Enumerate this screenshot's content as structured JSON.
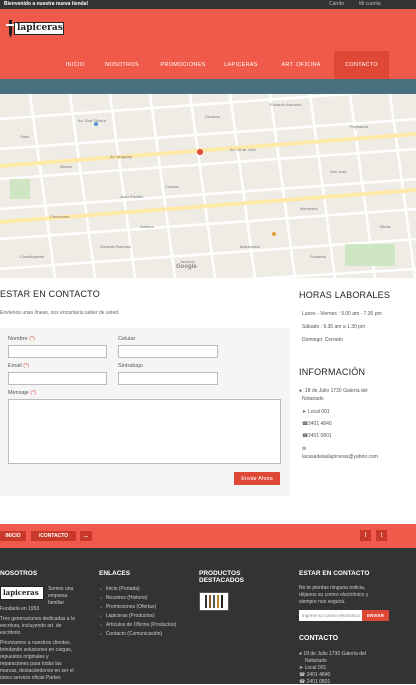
{
  "topbar": {
    "welcome": "Bienvenido a nuestra nueva tienda!",
    "cart": "Carrito",
    "account": "Mi cuenta"
  },
  "brand": {
    "logo_text": "lapiceras"
  },
  "nav": {
    "items": [
      {
        "label": "Inicio"
      },
      {
        "label": "Nosotros"
      },
      {
        "label": "Promociones"
      },
      {
        "label": "Lapiceras"
      },
      {
        "label": "Art. Oficina"
      },
      {
        "label": "Contacto"
      }
    ],
    "active": "Contacto"
  },
  "map": {
    "labels": [
      "Av. Uruguay",
      "Av. 18 de Julio",
      "Av. Gral. Rivera",
      "Colonia",
      "Mercedes",
      "Canelones",
      "Maldonado",
      "Paysandú",
      "Soriano",
      "San José",
      "Constituyente",
      "Durazno",
      "Gonzalo Ramírez",
      "Eduardo Acevedo",
      "Juan Paullier",
      "Minas",
      "Blanes",
      "Salto",
      "Jackson",
      "Scoseria"
    ],
    "watermark": "Google"
  },
  "contact": {
    "title": "ESTAR EN CONTACTO",
    "subtitle": "Envíenos unas líneas, nos encantaría saber de usted.",
    "labels": {
      "name": "Nombre",
      "phone": "Celular",
      "email": "Email",
      "subject": "Sintrabajo",
      "message": "Mensaje"
    },
    "required_mark": "(*)",
    "submit": "Enviar Ahora"
  },
  "hours": {
    "title": "HORAS LABORALES",
    "lines": [
      "Lunes - Viernes : 9.00 am - 7.30 pm",
      "Sábado : 9.30 am a 1.30 pm",
      "Domingo: Cerrado"
    ]
  },
  "info": {
    "title": "INFORMACIÓN",
    "address_1": "18 de Julio 1730 Galería del",
    "address_2": "Notariado",
    "local": "Local 001",
    "phone_1": "2401 4840",
    "phone_2": "2401 0801",
    "email": "lacasadelaslapiceras@yahoo.com"
  },
  "breadcrumb": {
    "items": [
      "INICIO",
      "/CONTACTO",
      "..."
    ]
  },
  "social": {
    "facebook": "f",
    "twitter": "t"
  },
  "footer": {
    "nosotros": {
      "title": "NOSOTROS",
      "tag_1": "Somos una",
      "tag_2": "empresa",
      "tag_3": "familiar",
      "founded": "Fundada en 1953",
      "p1": [
        "Tres generaciones dedicadas a la",
        "escritura, incluyendo art. de",
        "escritorio."
      ],
      "p2": [
        "Priorizamos a nuestros clientes,",
        "brindando soluciones en cargas,",
        "repuestos originales y",
        "reparaciones para todas las",
        "marcas, destacándonos en ser el",
        "único servicio oficial Parker."
      ]
    },
    "enlaces": {
      "title": "ENLACES",
      "items": [
        "Inicio (Portada)",
        "Nosotros (Historia)",
        "Promociones (Ofertas)",
        "Lapiceras (Productos)",
        "Artículos de Oficina (Productos)",
        "Contacto (Comunicación)"
      ]
    },
    "productos": {
      "title_1": "PRODUCTOS",
      "title_2": "DESTACADOS"
    },
    "newsletter": {
      "title": "ESTAR EN CONTACTO",
      "text": [
        "No te pierdas ninguna noticia,",
        "déjanos su correo electrónico y",
        "siempre nos seguirá."
      ],
      "placeholder": "Ingrese su correo electrónico",
      "button": "ENVIAR"
    },
    "contacto": {
      "title": "CONTACTO",
      "address_1": "18 de Julio 1730 Galería del",
      "address_2": "Notariado",
      "local": "Local 001",
      "phone_1": "2401 4840",
      "phone_2": "2401 0801"
    }
  },
  "colors": {
    "brand_red": "#f05a4a",
    "dark_red": "#e04836",
    "teal": "#4a7080",
    "footer_bg": "#333333"
  }
}
